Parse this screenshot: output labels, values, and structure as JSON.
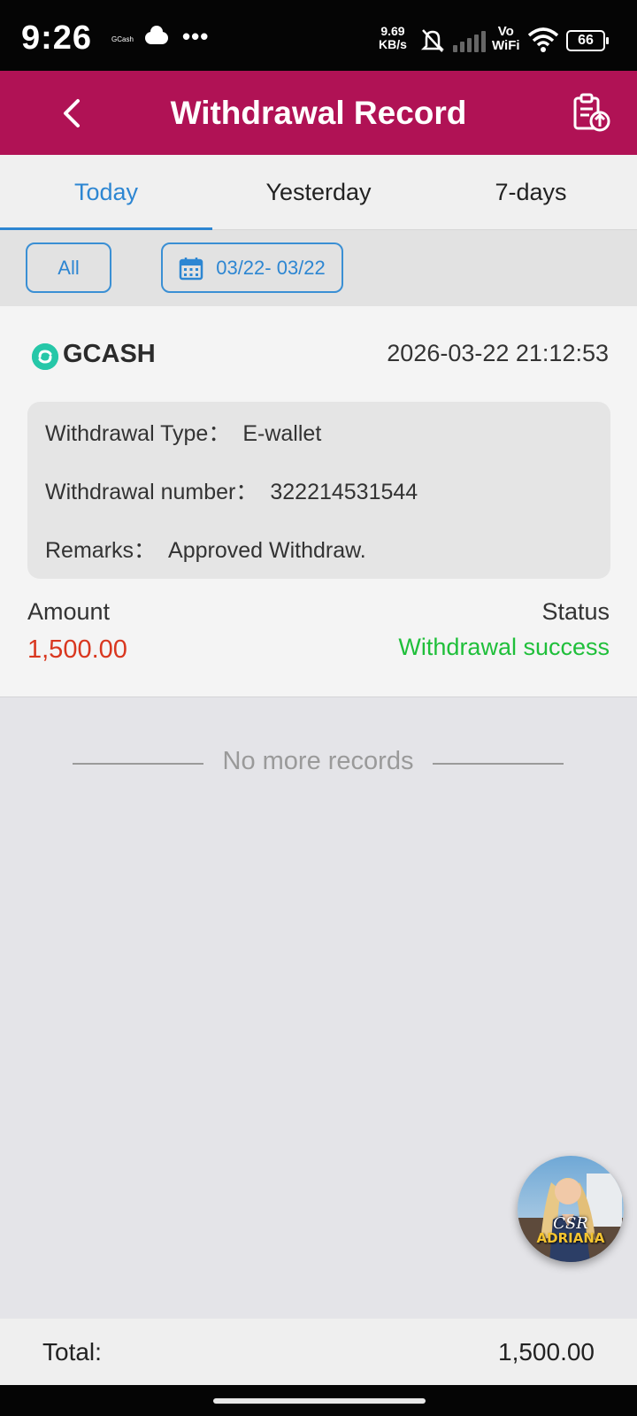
{
  "status_bar": {
    "time": "9:26",
    "notification_app": "GCash",
    "net_speed_value": "9.69",
    "net_speed_unit": "KB/s",
    "vowifi_top": "Vo",
    "vowifi_bottom": "WiFi",
    "battery": "66"
  },
  "header": {
    "title": "Withdrawal Record",
    "back_icon": "chevron-left-icon",
    "export_icon": "clipboard-upload-icon"
  },
  "tabs": [
    {
      "label": "Today",
      "active": true
    },
    {
      "label": "Yesterday",
      "active": false
    },
    {
      "label": "7-days",
      "active": false
    }
  ],
  "filters": {
    "all_label": "All",
    "date_range": "03/22- 03/22",
    "date_icon": "calendar-icon"
  },
  "record": {
    "method": "GCASH",
    "datetime": "2026-03-22 21:12:53",
    "type_label": "Withdrawal Type：",
    "type_value": "E-wallet",
    "number_label": "Withdrawal number：",
    "number_value": "322214531544",
    "remarks_label": "Remarks：",
    "remarks_value": "Approved Withdraw.",
    "amount_label": "Amount",
    "amount_value": "1,500.00",
    "status_label": "Status",
    "status_value": "Withdrawal success"
  },
  "list_end": "No more records",
  "avatar": {
    "line1": "CSR",
    "line2": "ADRIANA"
  },
  "total": {
    "label": "Total:",
    "value": "1,500.00"
  },
  "colors": {
    "header": "#b01255",
    "accent": "#2d86d2",
    "amount": "#d9371f",
    "success": "#1fbf3a"
  }
}
